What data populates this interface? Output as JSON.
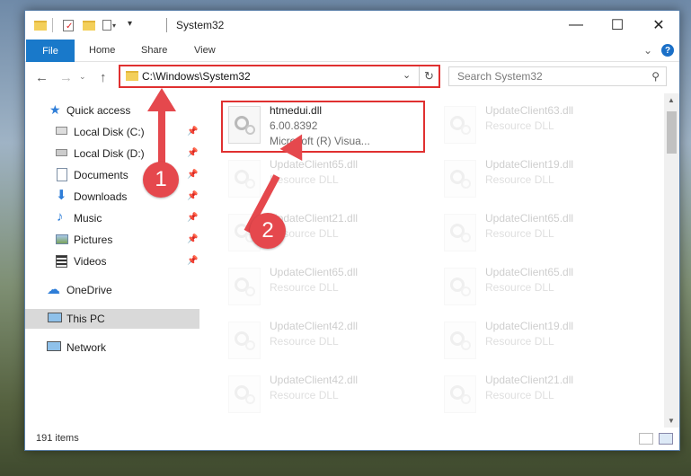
{
  "window": {
    "title": "System32",
    "minimize": "—",
    "maximize": "☐",
    "close": "✕"
  },
  "ribbon": {
    "tabs": [
      "File",
      "Home",
      "Share",
      "View"
    ],
    "help": "?"
  },
  "address": {
    "path": "C:\\Windows\\System32",
    "dropdown": "⌄",
    "refresh": "↻"
  },
  "search": {
    "placeholder": "Search System32"
  },
  "nav": {
    "items": [
      {
        "label": "Quick access",
        "icon": "star-icon"
      },
      {
        "label": "Local Disk (C:)",
        "icon": "drive-icon",
        "pinned": true
      },
      {
        "label": "Local Disk (D:)",
        "icon": "drive-icon",
        "pinned": true
      },
      {
        "label": "Documents",
        "icon": "documents-icon",
        "pinned": true
      },
      {
        "label": "Downloads",
        "icon": "download-icon",
        "pinned": true
      },
      {
        "label": "Music",
        "icon": "music-icon",
        "pinned": true
      },
      {
        "label": "Pictures",
        "icon": "pictures-icon",
        "pinned": true
      },
      {
        "label": "Videos",
        "icon": "videos-icon",
        "pinned": true
      },
      {
        "label": "OneDrive",
        "icon": "cloud-icon"
      },
      {
        "label": "This PC",
        "icon": "computer-icon",
        "selected": true
      },
      {
        "label": "Network",
        "icon": "network-icon"
      }
    ]
  },
  "files": [
    {
      "name": "htmedui.dll",
      "line2": "6.00.8392",
      "line3": "Microsoft (R) Visua..."
    },
    {
      "name": "UpdateClient63.dll",
      "line2": "Resource DLL"
    },
    {
      "name": "UpdateClient65.dll",
      "line2": "Resource DLL"
    },
    {
      "name": "UpdateClient19.dll",
      "line2": "Resource DLL"
    },
    {
      "name": "UpdateClient21.dll",
      "line2": "Resource DLL"
    },
    {
      "name": "UpdateClient65.dll",
      "line2": "Resource DLL"
    },
    {
      "name": "UpdateClient65.dll",
      "line2": "Resource DLL"
    },
    {
      "name": "UpdateClient65.dll",
      "line2": "Resource DLL"
    },
    {
      "name": "UpdateClient42.dll",
      "line2": "Resource DLL"
    },
    {
      "name": "UpdateClient19.dll",
      "line2": "Resource DLL"
    },
    {
      "name": "UpdateClient42.dll",
      "line2": "Resource DLL"
    },
    {
      "name": "UpdateClient21.dll",
      "line2": "Resource DLL"
    }
  ],
  "status": {
    "count": "191 items"
  },
  "annotations": {
    "step1": "1",
    "step2": "2",
    "color": "#e5484d"
  }
}
